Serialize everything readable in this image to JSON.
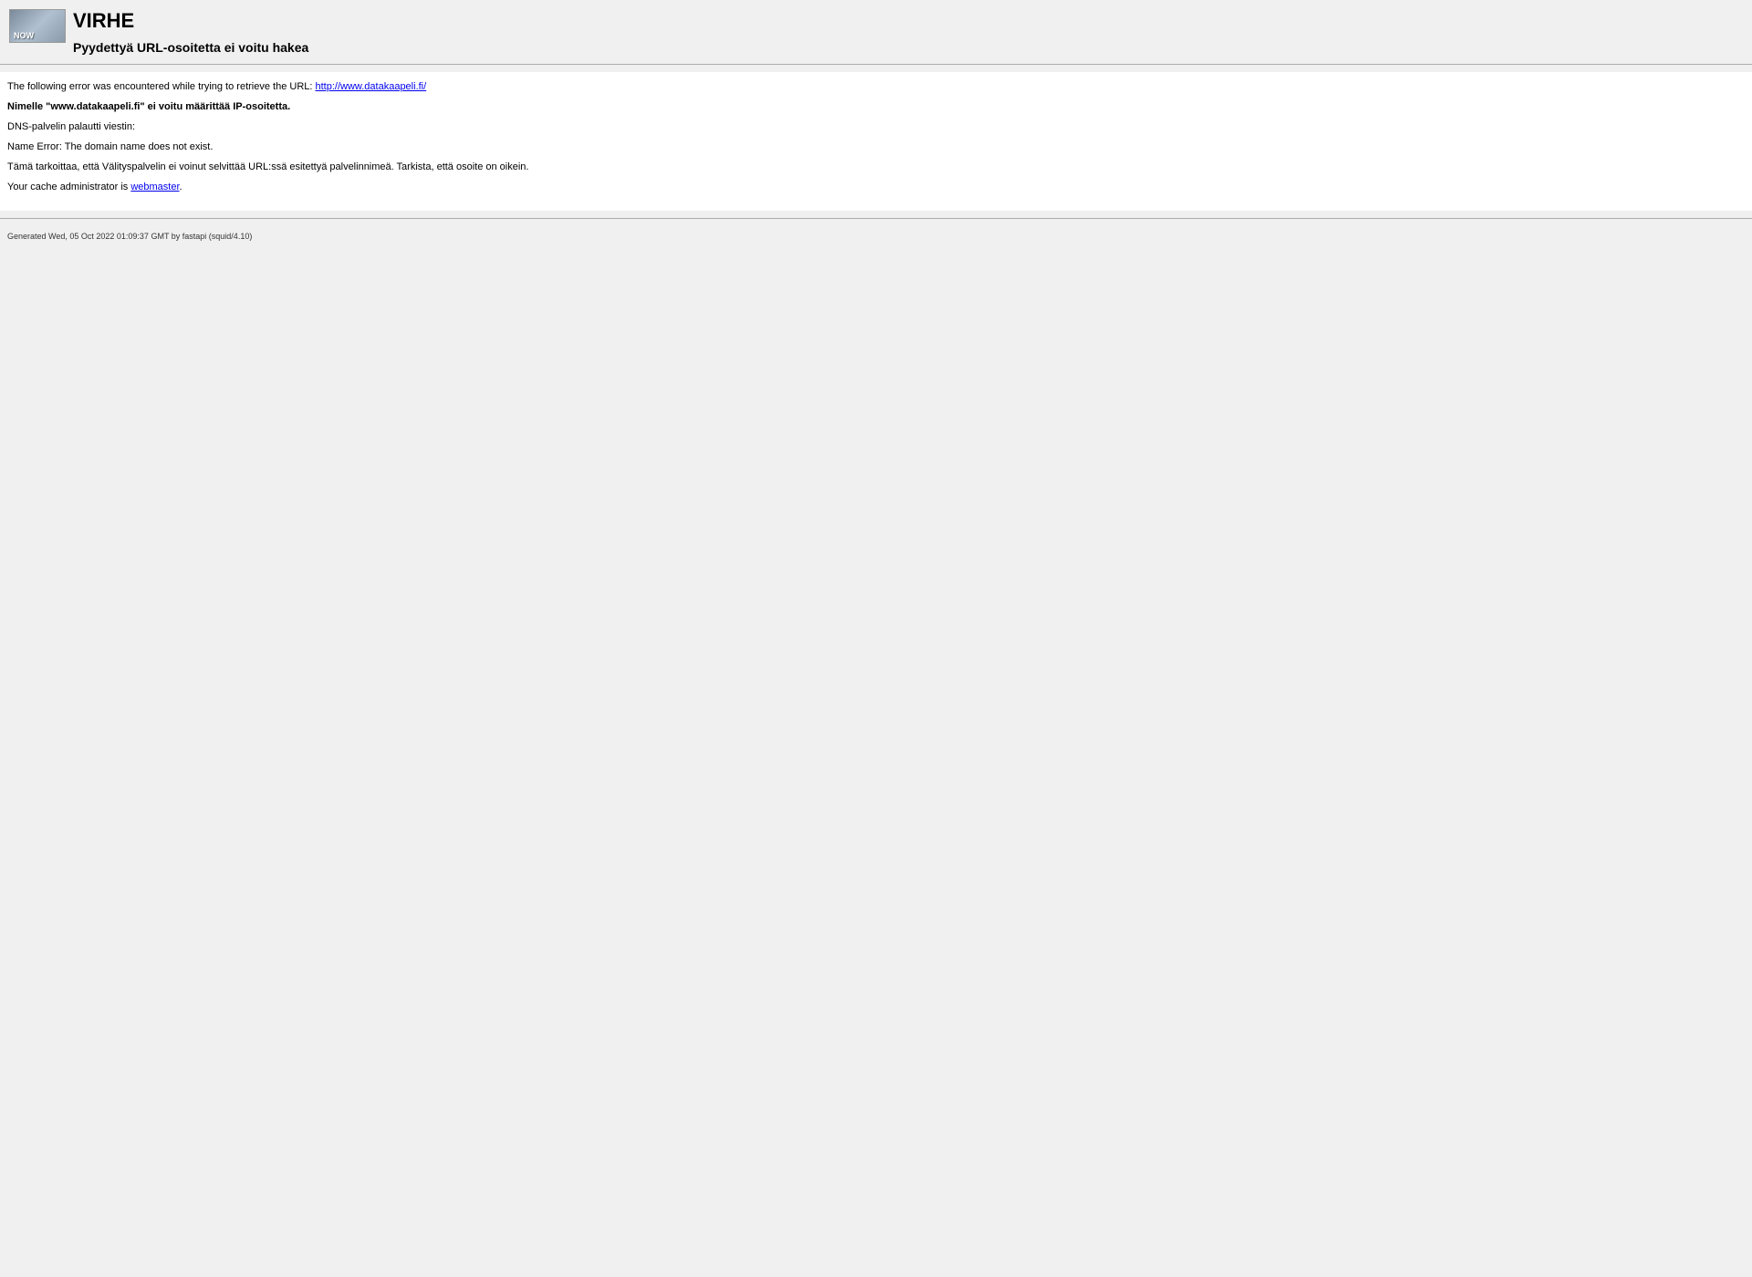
{
  "header": {
    "title": "VIRHE",
    "subtitle": "Pyydettyä URL-osoitetta ei voitu hakea"
  },
  "content": {
    "intro_text": "The following error was encountered while trying to retrieve the URL: ",
    "url": "http://www.datakaapeli.fi/",
    "error_bold": "Nimelle \"www.datakaapeli.fi\" ei voitu määrittää IP-osoitetta.",
    "dns_label": "DNS-palvelin palautti viestin:",
    "dns_message": "Name Error: The domain name does not exist.",
    "explanation": "Tämä tarkoittaa, että Välityspalvelin ei voinut selvittää URL:ssä esitettyä palvelinnimeä. Tarkista, että osoite on oikein.",
    "admin_prefix": "Your cache administrator is ",
    "admin_link": "webmaster",
    "admin_suffix": "."
  },
  "footer": {
    "generated": "Generated Wed, 05 Oct 2022 01:09:37 GMT by fastapi (squid/4.10)"
  }
}
